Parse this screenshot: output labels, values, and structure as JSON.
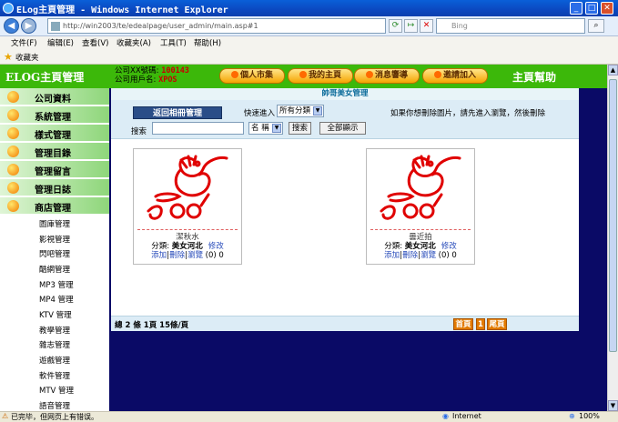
{
  "window": {
    "title": "ELog主頁管理 - Windows Internet Explorer",
    "min": "_",
    "max": "□",
    "close": "✕"
  },
  "nav": {
    "address": "http://win2003/te/edealpage/user_admin/main.asp#1",
    "search_placeholder": "Bing"
  },
  "menu": [
    "文件(F)",
    "编辑(E)",
    "查看(V)",
    "收藏夹(A)",
    "工具(T)",
    "帮助(H)"
  ],
  "favorites": "收藏夹",
  "header": {
    "brand": "ELOG主頁管理",
    "account_label": "公司XX號碼:",
    "account_value": "100143",
    "user_label": "公司用戶名:",
    "user_value": "XPOS",
    "buttons": [
      "個人市集",
      "我的主頁",
      "消息響導",
      "邀請加入"
    ],
    "help": "主頁幫助"
  },
  "sidebar": {
    "categories": [
      "公司資料",
      "系統管理",
      "樣式管理",
      "管理目錄",
      "管理留言",
      "管理日誌",
      "商店管理"
    ],
    "items": [
      "圖庫管理",
      "影視管理",
      "閃吧管理",
      "酷網管理",
      "MP3 管理",
      "MP4 管理",
      "KTV 管理",
      "教學管理",
      "雜志管理",
      "遊戲管理",
      "軟件管理",
      "MTV 管理",
      "語音管理"
    ]
  },
  "main": {
    "title": "帥哥美女管理",
    "back_button": "返回相冊管理",
    "quick_label": "快速進入",
    "quick_value": "所有分類",
    "hint": "如果你想刪除圖片，請先進入瀏覽，然後刪除",
    "search_label": "搜索",
    "search_value": "",
    "field_value": "名 稱",
    "search_button": "搜索",
    "show_all_button": "全部顯示"
  },
  "cards": [
    {
      "name": "潔秋水",
      "cat_label": "分類:",
      "cat_value": "美女河北",
      "edit": "修改",
      "add": "添加",
      "del": "刪除",
      "browse": "瀏覽",
      "count": "(0)  0"
    },
    {
      "name": "曇近拍",
      "cat_label": "分類:",
      "cat_value": "美女河北",
      "edit": "修改",
      "add": "添加",
      "del": "刪除",
      "browse": "瀏覽",
      "count": "(0)  0"
    }
  ],
  "footer": {
    "total": "總 2 條 1頁 15條/頁",
    "first": "首頁",
    "page": "1",
    "last": "尾頁"
  },
  "status": {
    "left": "已完毕，但网页上有错误。",
    "zone": "Internet",
    "zoom": "100%"
  },
  "colors": {
    "header_green": "#3cb80a",
    "page_navy": "#0a0a66",
    "logo_red": "#e00000"
  }
}
